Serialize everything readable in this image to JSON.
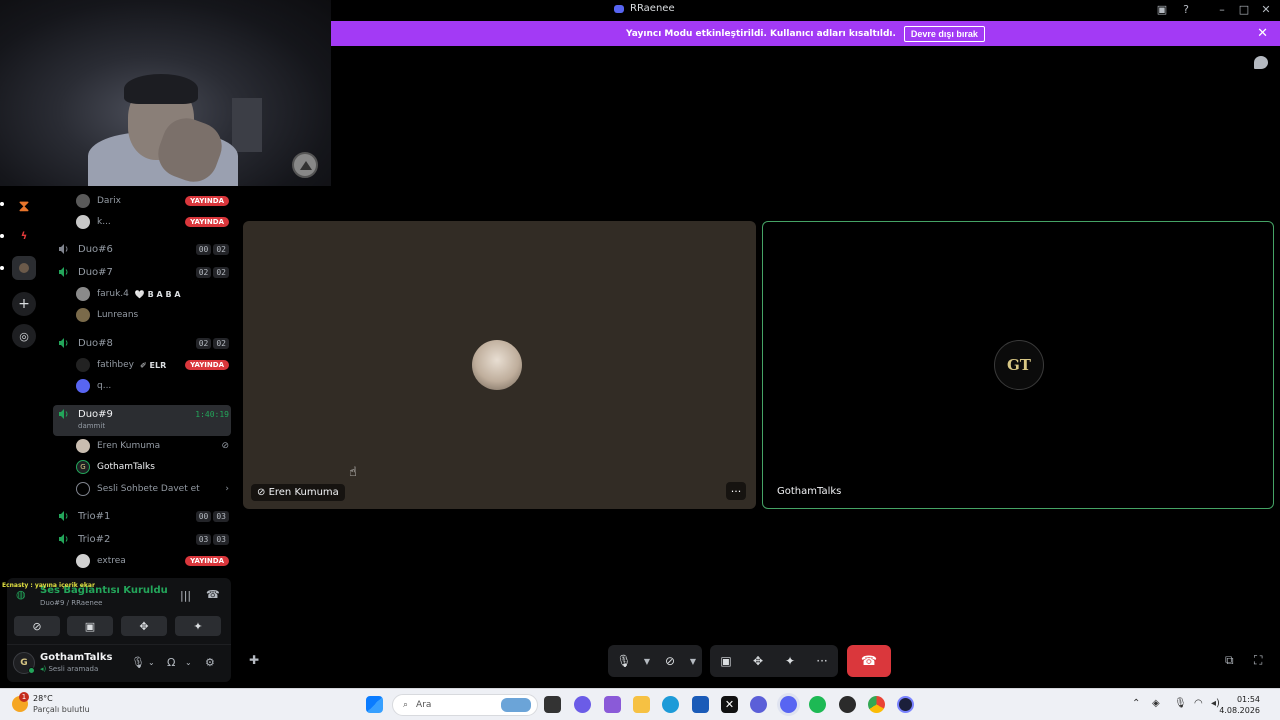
{
  "window": {
    "title": "RRaenee"
  },
  "banner": {
    "message": "Yayıncı Modu etkinleştirildi. Kullanıcı adları kısaltıldı.",
    "disable_label": "Devre dışı bırak"
  },
  "channels": [
    {
      "name": "Duo#6",
      "counts": [
        "00",
        "02"
      ]
    },
    {
      "name": "Duo#7",
      "counts": [
        "02",
        "02"
      ]
    },
    {
      "name": "Duo#8",
      "counts": [
        "02",
        "02"
      ]
    },
    {
      "name": "Duo#9",
      "timer": "1:40:19",
      "status": "dammit"
    },
    {
      "name": "Trio#1",
      "counts": [
        "00",
        "03"
      ]
    },
    {
      "name": "Trio#2",
      "counts": [
        "03",
        "03"
      ]
    }
  ],
  "users": {
    "darix": "Darix",
    "k": "k...",
    "faruk": "faruk.4",
    "faruk_tag": "🤍 B A B A",
    "lunreans": "Lunreans",
    "fatihbey": "fatihbey",
    "fatihbey_tag": "ELR",
    "q": "q...",
    "eren": "Eren Kumuma",
    "gotham": "GothamTalks",
    "invite": "Sesli Sohbete Davet et",
    "extrea": "extrea",
    "live_label": "YAYINDA"
  },
  "voice_panel": {
    "overlay_text": "Ecnasty : yayına içerik ekar",
    "status": "Ses Bağlantısı Kuruldu",
    "location": "Duo#9 / RRaenee",
    "username": "GothamTalks",
    "user_status": "Sesli aramada"
  },
  "tiles": [
    {
      "label": "Eren Kumuma",
      "muted_video": true
    },
    {
      "label": "GothamTalks",
      "speaking": true
    }
  ],
  "taskbar": {
    "temperature": "28°C",
    "weather": "Parçalı bulutlu",
    "weather_badge": "1",
    "search_placeholder": "Ara",
    "time": "01:54",
    "date": "4.08.2026"
  },
  "colors": {
    "banner": "#a33af5",
    "live": "#da373c",
    "speaking_border": "#45a365",
    "connected": "#23a55a"
  }
}
